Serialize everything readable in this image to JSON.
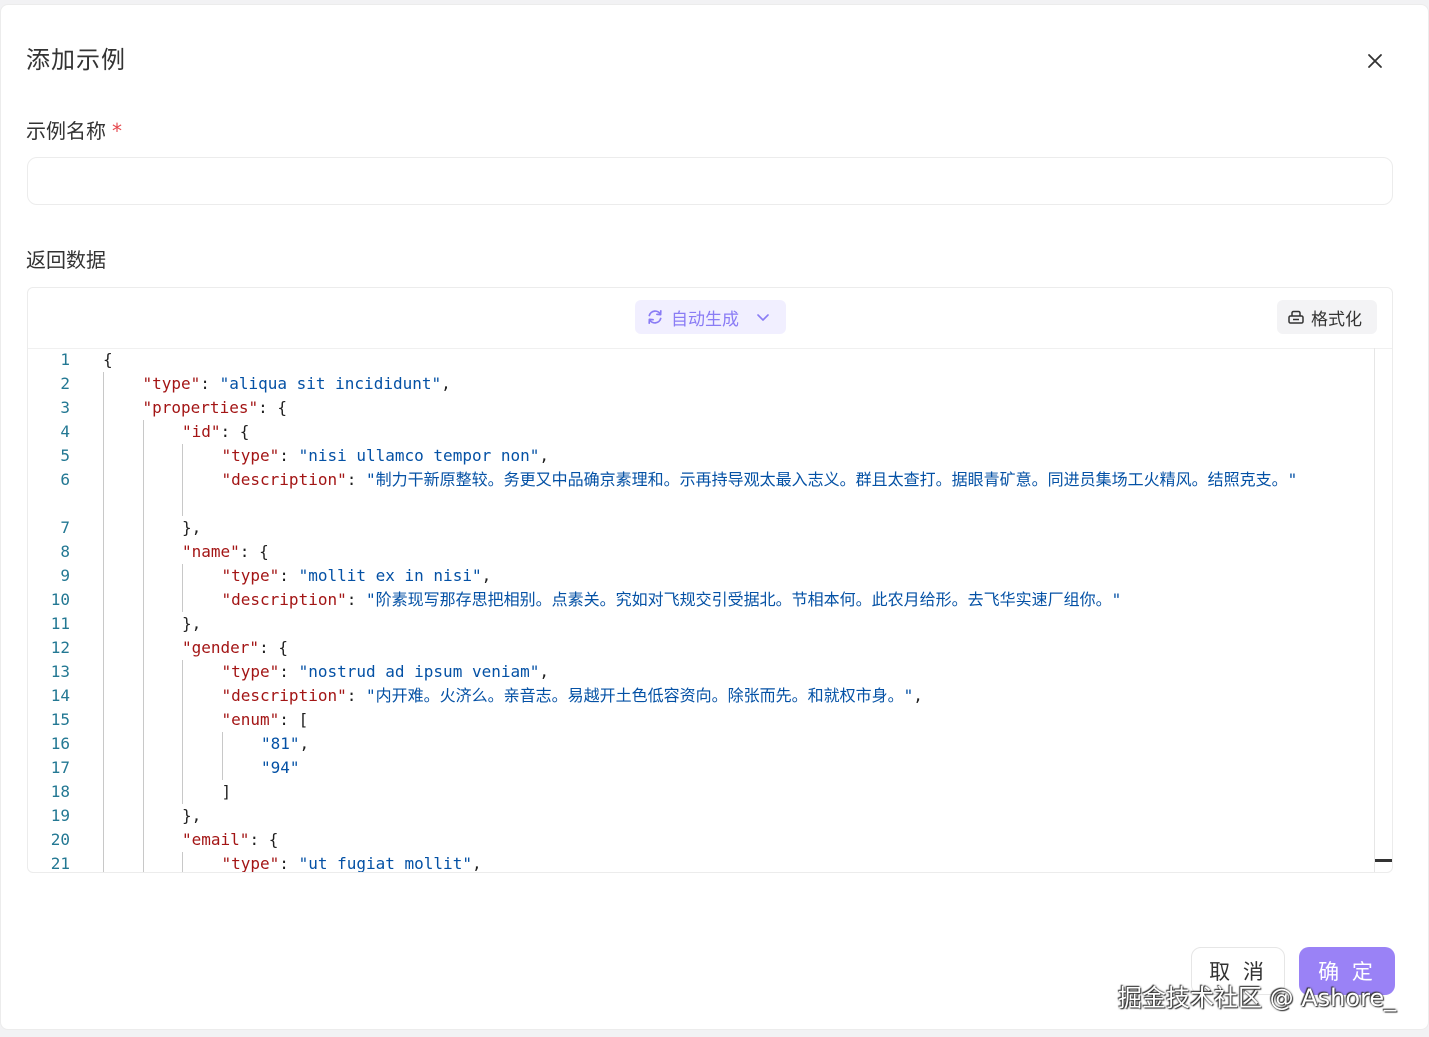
{
  "dialog": {
    "title": "添加示例",
    "name_label": "示例名称",
    "required_mark": "*",
    "name_value": "",
    "return_label": "返回数据"
  },
  "editor": {
    "autogen_label": "自动生成",
    "format_label": "格式化",
    "lines": [
      {
        "n": "1",
        "indent": 0,
        "parts": [
          [
            "p",
            "{"
          ]
        ]
      },
      {
        "n": "2",
        "indent": 1,
        "parts": [
          [
            "k",
            "\"type\""
          ],
          [
            "p",
            ": "
          ],
          [
            "s",
            "\"aliqua sit incididunt\""
          ],
          [
            "p",
            ","
          ]
        ]
      },
      {
        "n": "3",
        "indent": 1,
        "parts": [
          [
            "k",
            "\"properties\""
          ],
          [
            "p",
            ": {"
          ]
        ]
      },
      {
        "n": "4",
        "indent": 2,
        "parts": [
          [
            "k",
            "\"id\""
          ],
          [
            "p",
            ": {"
          ]
        ]
      },
      {
        "n": "5",
        "indent": 3,
        "parts": [
          [
            "k",
            "\"type\""
          ],
          [
            "p",
            ": "
          ],
          [
            "s",
            "\"nisi ullamco tempor non\""
          ],
          [
            "p",
            ","
          ]
        ]
      },
      {
        "n": "6",
        "indent": 3,
        "wrap": true,
        "parts": [
          [
            "k",
            "\"description\""
          ],
          [
            "p",
            ": "
          ],
          [
            "s",
            "\"制力干新原整较。务更又中品确京素理和。示再持导观太最入志义。群且太查打。据眼青矿意。同进员集场工火精风。结照克支。\""
          ]
        ]
      },
      {
        "n": "7",
        "indent": 2,
        "parts": [
          [
            "p",
            "},"
          ]
        ]
      },
      {
        "n": "8",
        "indent": 2,
        "parts": [
          [
            "k",
            "\"name\""
          ],
          [
            "p",
            ": {"
          ]
        ]
      },
      {
        "n": "9",
        "indent": 3,
        "parts": [
          [
            "k",
            "\"type\""
          ],
          [
            "p",
            ": "
          ],
          [
            "s",
            "\"mollit ex in nisi\""
          ],
          [
            "p",
            ","
          ]
        ]
      },
      {
        "n": "10",
        "indent": 3,
        "parts": [
          [
            "k",
            "\"description\""
          ],
          [
            "p",
            ": "
          ],
          [
            "s",
            "\"阶素现写那存思把相别。点素关。究如对飞规交引受据北。节相本何。此农月给形。去飞华实速厂组你。\""
          ]
        ]
      },
      {
        "n": "11",
        "indent": 2,
        "parts": [
          [
            "p",
            "},"
          ]
        ]
      },
      {
        "n": "12",
        "indent": 2,
        "parts": [
          [
            "k",
            "\"gender\""
          ],
          [
            "p",
            ": {"
          ]
        ]
      },
      {
        "n": "13",
        "indent": 3,
        "parts": [
          [
            "k",
            "\"type\""
          ],
          [
            "p",
            ": "
          ],
          [
            "s",
            "\"nostrud ad ipsum veniam\""
          ],
          [
            "p",
            ","
          ]
        ]
      },
      {
        "n": "14",
        "indent": 3,
        "parts": [
          [
            "k",
            "\"description\""
          ],
          [
            "p",
            ": "
          ],
          [
            "s",
            "\"内开难。火济么。亲音志。易越开土色低容资向。除张而先。和就权市身。\""
          ],
          [
            "p",
            ","
          ]
        ]
      },
      {
        "n": "15",
        "indent": 3,
        "parts": [
          [
            "k",
            "\"enum\""
          ],
          [
            "p",
            ": ["
          ]
        ]
      },
      {
        "n": "16",
        "indent": 4,
        "parts": [
          [
            "s",
            "\"81\""
          ],
          [
            "p",
            ","
          ]
        ]
      },
      {
        "n": "17",
        "indent": 4,
        "parts": [
          [
            "s",
            "\"94\""
          ]
        ]
      },
      {
        "n": "18",
        "indent": 3,
        "parts": [
          [
            "p",
            "]"
          ]
        ]
      },
      {
        "n": "19",
        "indent": 2,
        "parts": [
          [
            "p",
            "},"
          ]
        ]
      },
      {
        "n": "20",
        "indent": 2,
        "parts": [
          [
            "k",
            "\"email\""
          ],
          [
            "p",
            ": {"
          ]
        ]
      },
      {
        "n": "21",
        "indent": 3,
        "parts": [
          [
            "k",
            "\"type\""
          ],
          [
            "p",
            ": "
          ],
          [
            "s",
            "\"ut fugiat mollit\""
          ],
          [
            "p",
            ","
          ]
        ]
      }
    ]
  },
  "footer": {
    "cancel_label": "取 消",
    "ok_label": "确 定"
  },
  "watermark": "掘金技术社区 @ Ashore_",
  "colors": {
    "primary": "#9a82f6",
    "json_key": "#a31515",
    "json_string": "#0451a5",
    "line_number": "#237893"
  }
}
